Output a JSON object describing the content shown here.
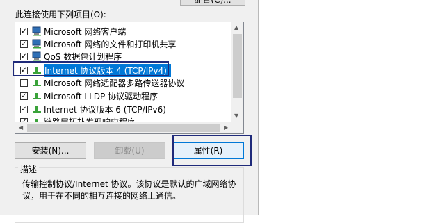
{
  "dialog": {
    "top_button_label": "配置(C)...",
    "list_label": "此连接使用下列项目(O):",
    "items": [
      {
        "label": "Microsoft 网络客户端",
        "checked": true,
        "icon": "network-client-icon"
      },
      {
        "label": "Microsoft 网络的文件和打印机共享",
        "checked": true,
        "icon": "network-client-icon"
      },
      {
        "label": "QoS 数据包计划程序",
        "checked": true,
        "icon": "network-client-icon"
      },
      {
        "label": "Internet 协议版本 4 (TCP/IPv4)",
        "checked": true,
        "selected": true,
        "icon": "protocol-icon"
      },
      {
        "label": "Microsoft 网络适配器多路传送器协议",
        "checked": false,
        "icon": "protocol-icon"
      },
      {
        "label": "Microsoft LLDP 协议驱动程序",
        "checked": true,
        "icon": "protocol-icon"
      },
      {
        "label": "Internet 协议版本 6 (TCP/IPv6)",
        "checked": true,
        "icon": "protocol-icon"
      },
      {
        "label": "链路层拓扑发现响应程序",
        "checked": true,
        "icon": "protocol-icon"
      }
    ],
    "buttons": {
      "install": "安装(N)...",
      "uninstall": "卸载(U)",
      "properties": "属性(R)"
    },
    "description_title": "描述",
    "description_text": "传输控制协议/Internet 协议。该协议是默认的广域网络协议，用于在不同的相互连接的网络上通信。",
    "colors": {
      "selection": "#0078d7",
      "annotation_frame": "#1f2a7a",
      "dialog_bg": "#f0f0f0"
    }
  }
}
